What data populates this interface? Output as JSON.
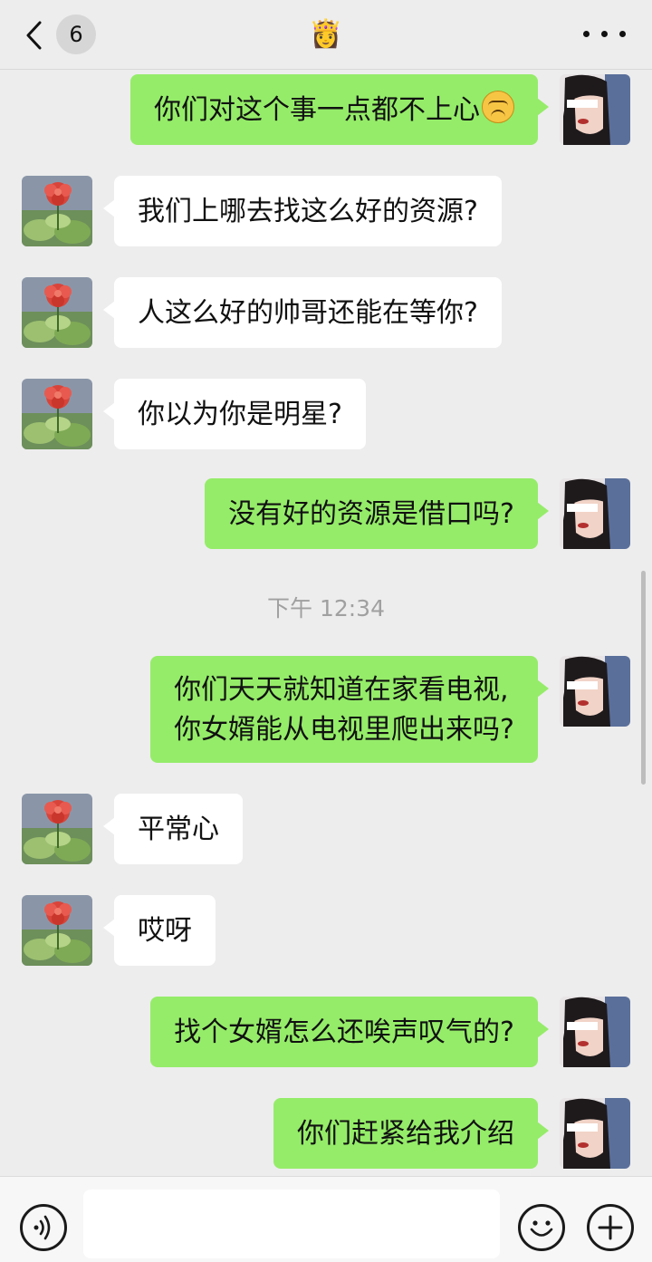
{
  "header": {
    "unread_count": "6",
    "title_emoji": "👸",
    "more_label": "•••"
  },
  "messages": [
    {
      "side": "out",
      "text": "你们对这个事一点都不上心",
      "emoji": "sad-face"
    },
    {
      "side": "in",
      "text": "我们上哪去找这么好的资源?"
    },
    {
      "side": "in",
      "text": "人这么好的帅哥还能在等你?"
    },
    {
      "side": "in",
      "text": "你以为你是明星?"
    },
    {
      "side": "out",
      "text": "没有好的资源是借口吗?"
    },
    {
      "side": "out",
      "lines": [
        "你们天天就知道在家看电视,",
        "你女婿能从电视里爬出来吗?"
      ]
    },
    {
      "side": "in",
      "text": "平常心"
    },
    {
      "side": "in",
      "text": "哎呀"
    },
    {
      "side": "out",
      "text": "找个女婿怎么还唉声叹气的?"
    },
    {
      "side": "out",
      "text": "你们赶紧给我介绍"
    }
  ],
  "timestamp": "下午 12:34",
  "input": {
    "placeholder": ""
  },
  "colors": {
    "outgoing_bubble": "#95ec69",
    "incoming_bubble": "#ffffff",
    "background": "#ededed"
  },
  "icons": {
    "back": "chevron-left-icon",
    "voice": "voice-icon",
    "emoji": "emoji-icon",
    "plus": "plus-icon",
    "avatar_left": "flower-avatar",
    "avatar_right": "girl-avatar"
  }
}
